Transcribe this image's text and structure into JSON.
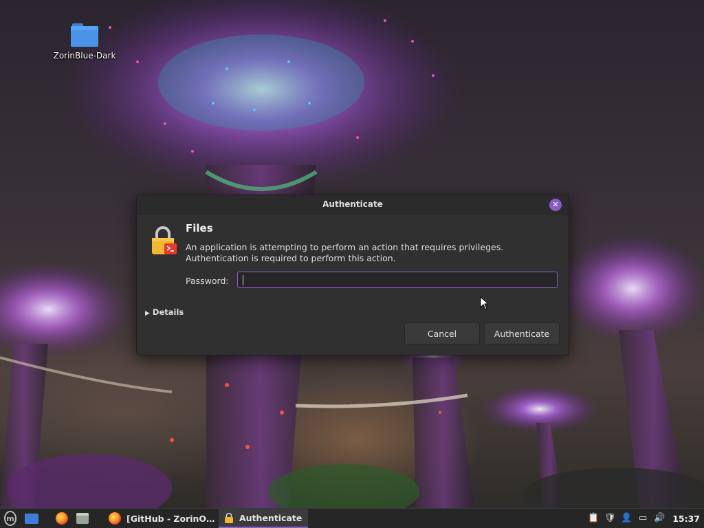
{
  "desktop": {
    "icons": [
      {
        "label": "ZorinBlue-Dark",
        "icon": "folder-icon"
      }
    ]
  },
  "dialog": {
    "title": "Authenticate",
    "app_name": "Files",
    "message": "An application is attempting to perform an action that requires privileges. Authentication is required to perform this action.",
    "password_label": "Password:",
    "password_value": "",
    "details_label": "Details",
    "cancel_label": "Cancel",
    "authenticate_label": "Authenticate",
    "accent_color": "#8a5cc7"
  },
  "taskbar": {
    "windows": [
      {
        "label": "[GitHub - ZorinO…",
        "icon": "firefox-icon",
        "active": false
      },
      {
        "label": "Authenticate",
        "icon": "lock-icon",
        "active": true
      }
    ],
    "tray_icons": [
      "clipboard-icon",
      "shield-update-icon",
      "user-icon",
      "network-icon",
      "volume-icon"
    ],
    "clock": "15:37"
  }
}
